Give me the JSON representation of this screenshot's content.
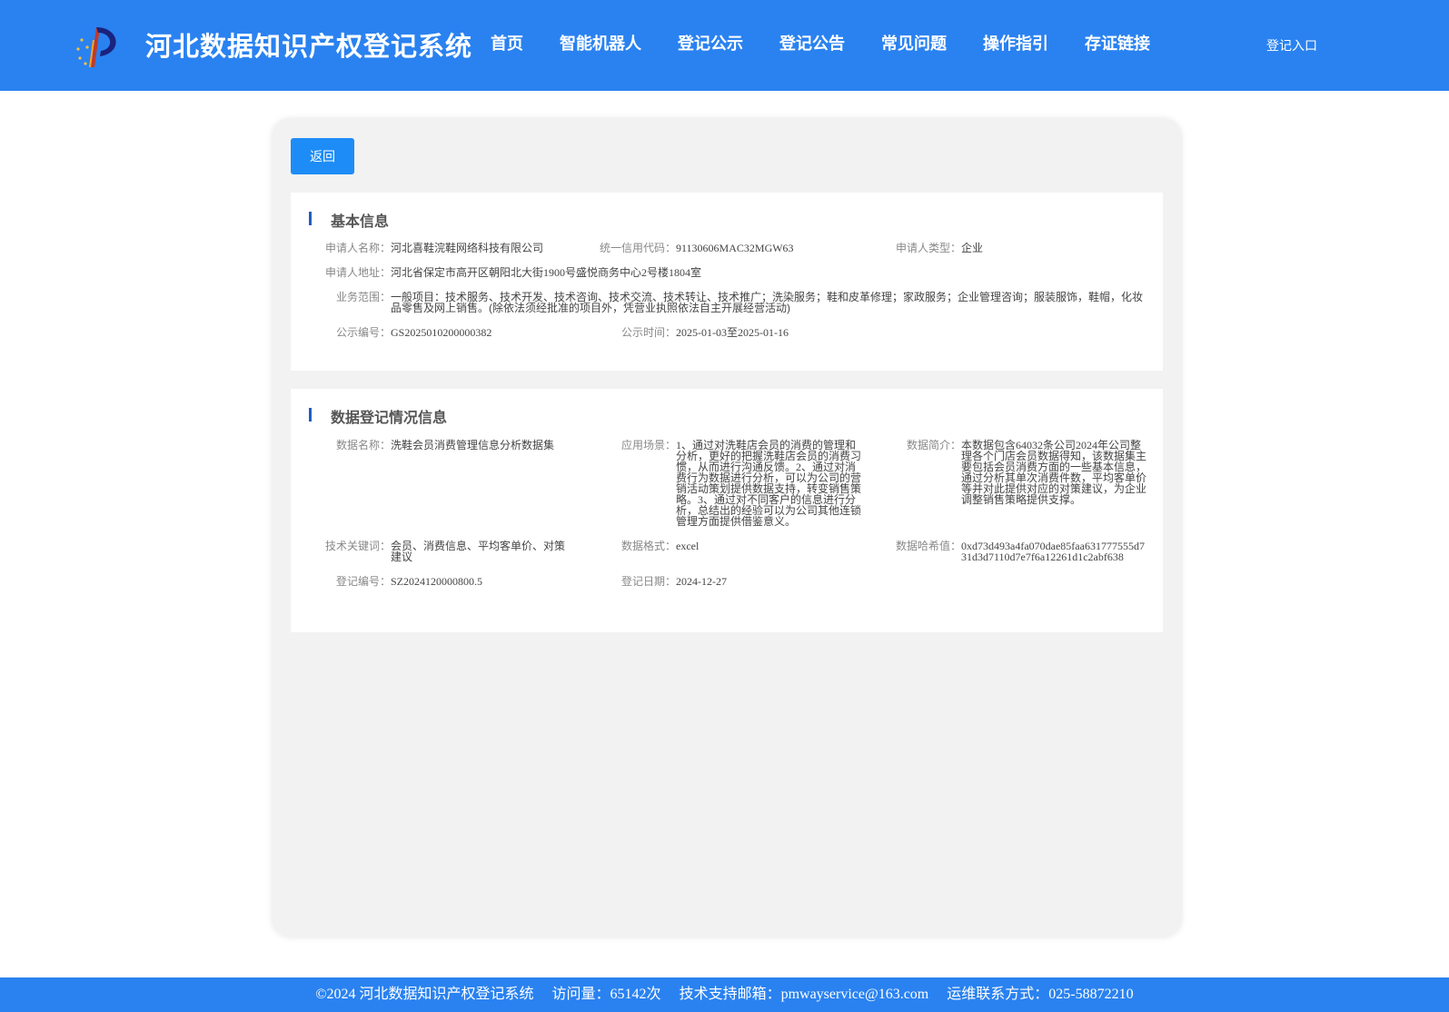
{
  "header": {
    "site_title": "河北数据知识产权登记系统",
    "nav": [
      "首页",
      "智能机器人",
      "登记公示",
      "登记公告",
      "常见问题",
      "操作指引",
      "存证链接"
    ],
    "login_label": "登记入口"
  },
  "main": {
    "back_label": "返回",
    "basic": {
      "title": "基本信息",
      "applicant_name_label": "申请人名称：",
      "applicant_name": "河北喜鞋浣鞋网络科技有限公司",
      "credit_code_label": "统一信用代码：",
      "credit_code": "91130606MAC32MGW63",
      "applicant_type_label": "申请人类型：",
      "applicant_type": "企业",
      "address_label": "申请人地址：",
      "address": "河北省保定市高开区朝阳北大街1900号盛悦商务中心2号楼1804室",
      "scope_label": "业务范围：",
      "scope": "一般项目：技术服务、技术开发、技术咨询、技术交流、技术转让、技术推广；洗染服务；鞋和皮革修理；家政服务；企业管理咨询；服装服饰，鞋帽，化妆品零售及网上销售。(除依法须经批准的项目外，凭营业执照依法自主开展经营活动)",
      "notice_no_label": "公示编号：",
      "notice_no": "GS2025010200000382",
      "notice_time_label": "公示时间：",
      "notice_time": "2025-01-03至2025-01-16"
    },
    "data": {
      "title": "数据登记情况信息",
      "name_label": "数据名称：",
      "name": "洗鞋会员消费管理信息分析数据集",
      "scenario_label": "应用场景：",
      "scenario": "1、通过对洗鞋店会员的消费的管理和分析，更好的把握洗鞋店会员的消费习惯，从而进行沟通反馈。2、通过对消费行为数据进行分析，可以为公司的营销活动策划提供数据支持，转变销售策略。3、通过对不同客户的信息进行分析，总结出的经验可以为公司其他连锁管理方面提供借鉴意义。",
      "intro_label": "数据简介：",
      "intro": "本数据包含64032条公司2024年公司整理各个门店会员数据得知，该数据集主要包括会员消费方面的一些基本信息，通过分析其单次消费件数，平均客单价等并对此提供对应的对策建议，为企业调整销售策略提供支撑。",
      "keywords_label": "技术关键词：",
      "keywords": "会员、消费信息、平均客单价、对策建议",
      "format_label": "数据格式：",
      "format": "excel",
      "hash_label": "数据哈希值：",
      "hash": "0xd73d493a4fa070dae85faa631777555d731d3d7110d7e7f6a12261d1c2abf638",
      "reg_no_label": "登记编号：",
      "reg_no": "SZ2024120000800.5",
      "reg_date_label": "登记日期：",
      "reg_date": "2024-12-27"
    }
  },
  "footer": {
    "copyright": "©2024 河北数据知识产权登记系统",
    "visits": "访问量：65142次",
    "email": "技术支持邮箱：pmwayservice@163.com",
    "contact": "运维联系方式：025-58872210"
  },
  "colors": {
    "brand_blue": "#2a82f0",
    "button_blue": "#1e8cf6",
    "title_bar": "#1e5fbf",
    "panel_bg": "#f2f2f2"
  }
}
